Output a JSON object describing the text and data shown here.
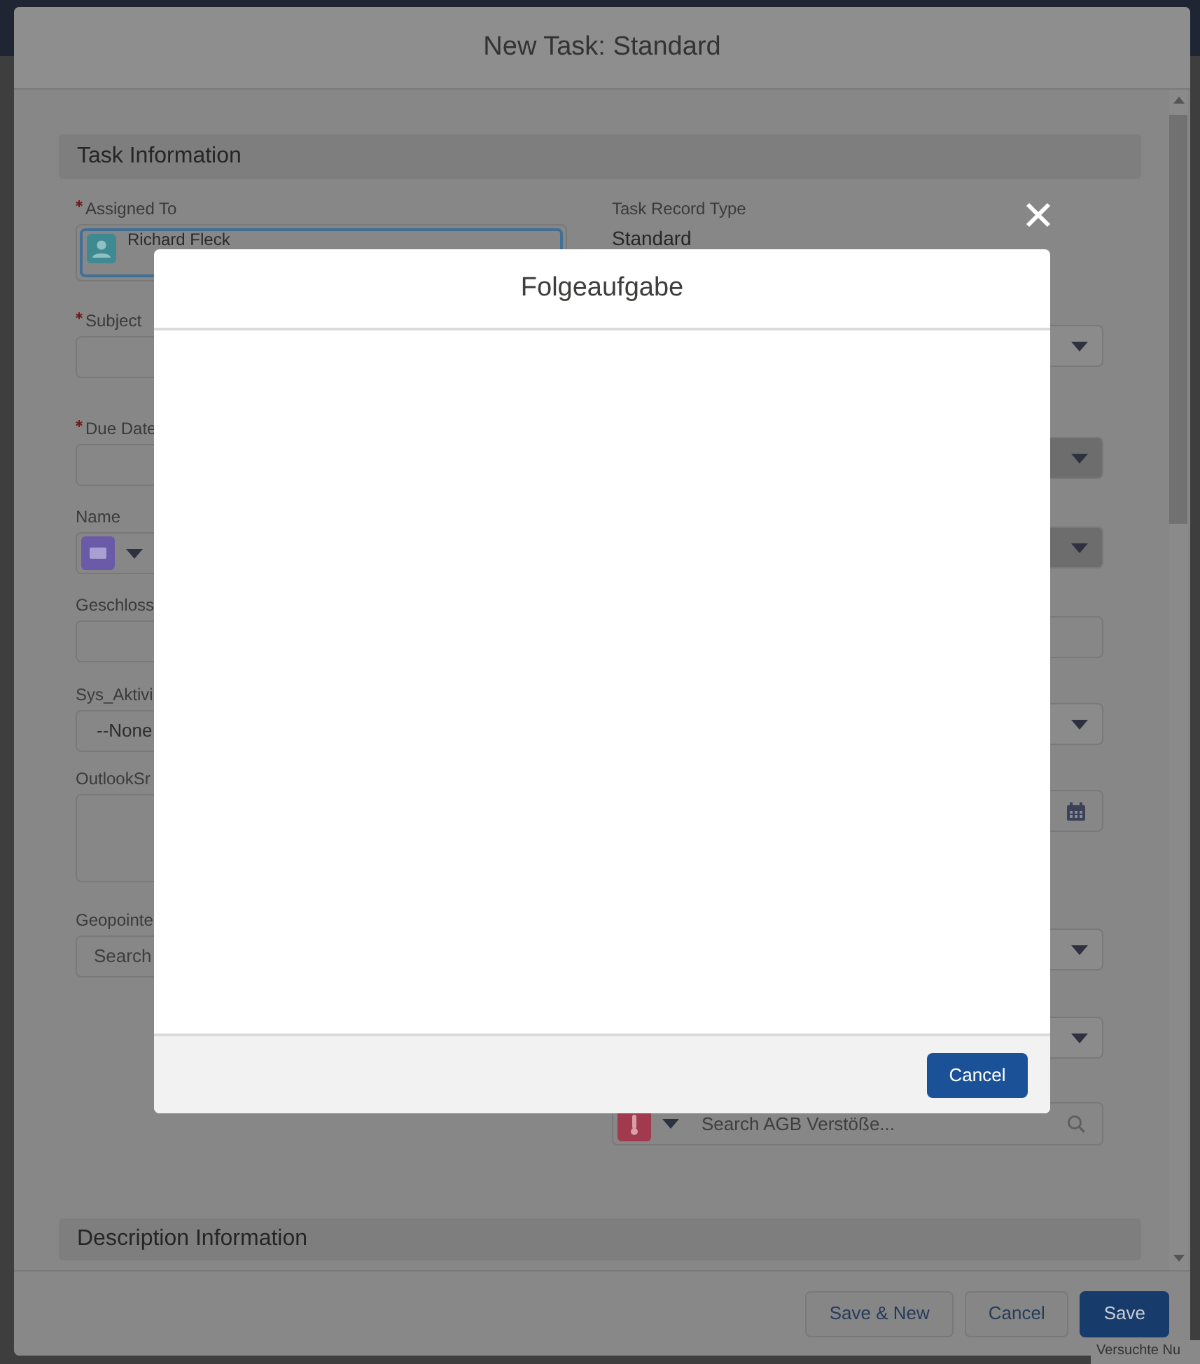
{
  "window": {
    "title": "New Task: Standard"
  },
  "task_information": {
    "title": "Task Information",
    "left_fields": [
      {
        "label": "Assigned To",
        "required": true,
        "kind": "lookup-user",
        "value": "Richard Fleck"
      },
      {
        "label": "Subject",
        "required": true,
        "kind": "text"
      },
      {
        "label": "Due Date",
        "required": true,
        "kind": "text"
      },
      {
        "label": "Name",
        "required": false,
        "kind": "lookup-contact"
      },
      {
        "label": "Geschloss",
        "required": false,
        "kind": "text"
      },
      {
        "label": "Sys_Aktivi",
        "required": false,
        "kind": "picklist",
        "value": "--None"
      },
      {
        "label": "OutlookSr",
        "required": false,
        "kind": "textarea"
      },
      {
        "label": "Geopointe",
        "required": false,
        "kind": "search",
        "placeholder": "Search"
      }
    ],
    "right_fields": [
      {
        "kind": "display",
        "label": "Task Record Type",
        "value": "Standard"
      },
      {
        "kind": "picklist",
        "disabled": false
      },
      {
        "kind": "picklist",
        "disabled": true
      },
      {
        "kind": "picklist",
        "disabled": true
      },
      {
        "kind": "text"
      },
      {
        "kind": "picklist",
        "disabled": false
      },
      {
        "kind": "date"
      },
      {
        "kind": "picklist",
        "disabled": false
      },
      {
        "kind": "picklist",
        "disabled": false
      },
      {
        "kind": "lookup-search",
        "placeholder": "Search AGB Verstöße..."
      }
    ]
  },
  "description_information": {
    "title": "Description Information"
  },
  "footer_buttons": [
    {
      "label": "Save & New",
      "primary": false
    },
    {
      "label": "Cancel",
      "primary": false
    },
    {
      "label": "Save",
      "primary": true
    }
  ],
  "dialog": {
    "title": "Folgeaufgabe",
    "buttons": [
      {
        "label": "Cancel",
        "primary": true
      }
    ]
  },
  "background_page": {
    "texts": [
      "Versuchte Nu"
    ]
  }
}
